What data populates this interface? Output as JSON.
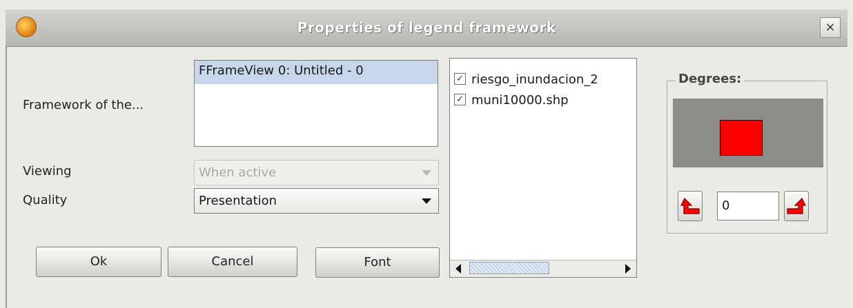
{
  "window": {
    "title": "Properties of legend framework",
    "close_symbol": "×",
    "icon": "app-logo-icon"
  },
  "form": {
    "framework_label": "Framework of the...",
    "framework_items": [
      "FFrameView 0: Untitled - 0"
    ],
    "viewing_label": "Viewing",
    "viewing_value": "When active",
    "quality_label": "Quality",
    "quality_value": "Presentation"
  },
  "buttons": {
    "ok": "Ok",
    "cancel": "Cancel",
    "font": "Font"
  },
  "layers": [
    {
      "label": "riesgo_inundacion_2",
      "checked": true
    },
    {
      "label": "muni10000.shp",
      "checked": true
    }
  ],
  "degrees": {
    "title": "Degrees:",
    "value": "0",
    "preview_color": "#ff0000",
    "preview_bg": "#8c8c89",
    "rotate_left_icon": "rotate-left-icon",
    "rotate_right_icon": "rotate-right-icon"
  }
}
